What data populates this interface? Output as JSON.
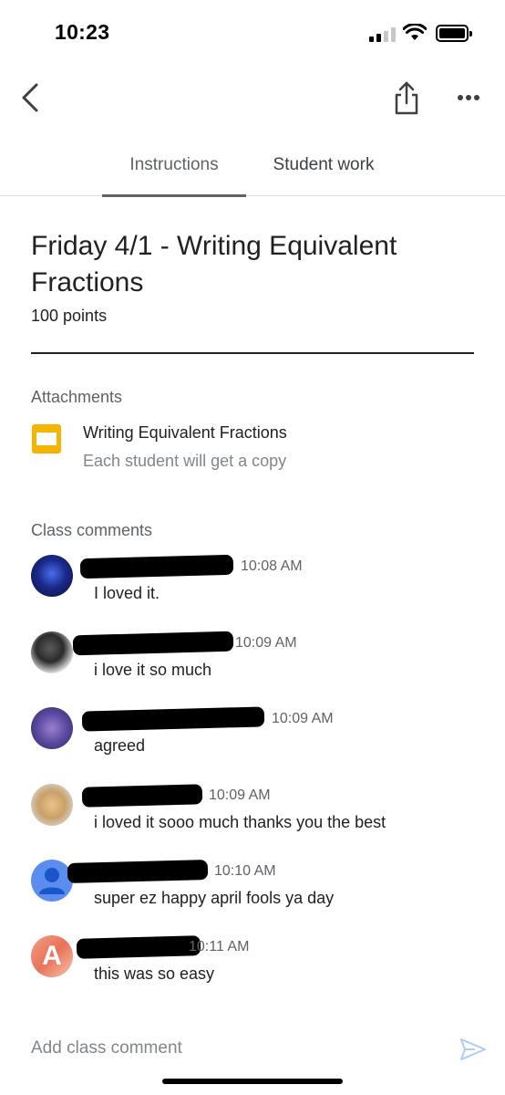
{
  "status_bar": {
    "time": "10:23"
  },
  "tabs": [
    {
      "label": "Instructions"
    },
    {
      "label": "Student work"
    }
  ],
  "assignment": {
    "title": "Friday 4/1 - Writing Equivalent Fractions",
    "points": "100 points"
  },
  "attachments": {
    "label": "Attachments",
    "items": [
      {
        "title": "Writing Equivalent Fractions",
        "subtitle": "Each student will get a copy"
      }
    ]
  },
  "comments": {
    "label": "Class comments",
    "items": [
      {
        "time": "10:08 AM",
        "text": "I loved it."
      },
      {
        "time": "10:09 AM",
        "text": "i love it so much"
      },
      {
        "time": "10:09 AM",
        "text": "agreed"
      },
      {
        "time": "10:09 AM",
        "text": "i loved it sooo much thanks you the best"
      },
      {
        "time": "10:10 AM",
        "text": "super ez happy april fools ya day"
      },
      {
        "time": "10:11 AM",
        "text": "this was so easy"
      }
    ],
    "avatar_letter": "A"
  },
  "composer": {
    "placeholder": "Add class comment"
  },
  "colors": {
    "accent": "#f4b400",
    "send": "#aecbfa",
    "muted": "#5f6368"
  }
}
